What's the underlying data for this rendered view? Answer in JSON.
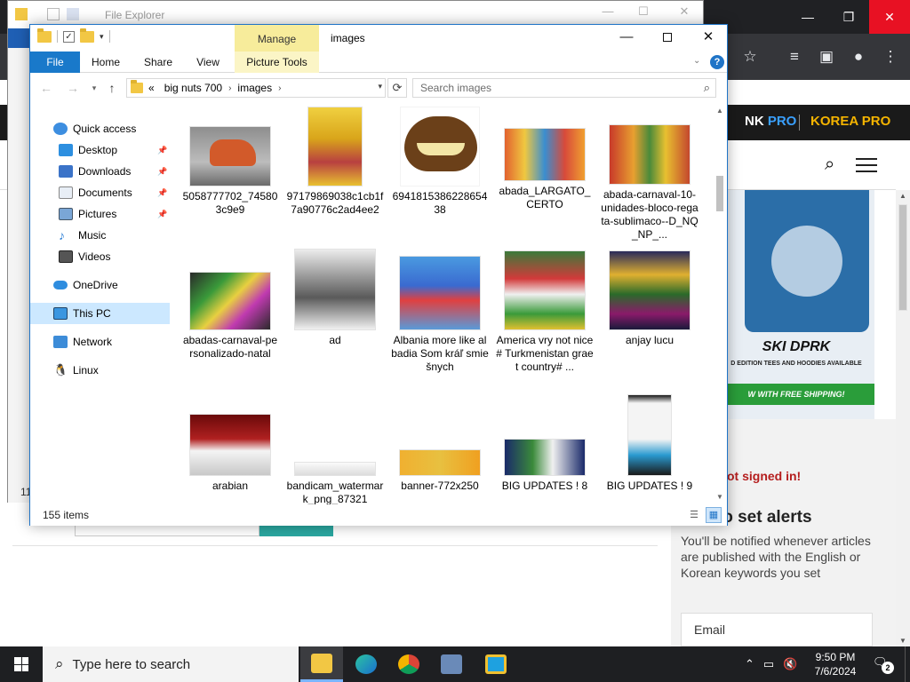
{
  "browser": {
    "header_left": "NK",
    "header_left_accent": "PRO",
    "header_right": "KOREA PRO",
    "ad_title": "SKI DPRK",
    "ad_sub": "D EDITION TEES AND HOODIES AVAILABLE",
    "ad_ship": "W WITH FREE SHIPPING!",
    "not_signed": "ot signed in!",
    "signin_title": "n to set alerts",
    "signin_desc": "You'll be notified whenever articles are published with the English or Korean keywords you set",
    "email_placeholder": "Email",
    "accent_red": "#b51e1e",
    "accent_green": "#2a9d3a"
  },
  "back_window": {
    "title": "File Explorer",
    "partial_count": "11"
  },
  "explorer": {
    "title": "images",
    "manage_label": "Manage",
    "tabs": {
      "file": "File",
      "home": "Home",
      "share": "Share",
      "view": "View",
      "picture_tools": "Picture Tools"
    },
    "address": {
      "overflow": "«",
      "crumbs": [
        "big nuts 700",
        "images"
      ]
    },
    "search_placeholder": "Search images",
    "nav": [
      {
        "label": "Quick access",
        "icon": "star-icon",
        "pinned": false
      },
      {
        "label": "Desktop",
        "icon": "desktop-icon",
        "pinned": true
      },
      {
        "label": "Downloads",
        "icon": "download-icon",
        "pinned": true
      },
      {
        "label": "Documents",
        "icon": "document-icon",
        "pinned": true
      },
      {
        "label": "Pictures",
        "icon": "picture-icon",
        "pinned": true
      },
      {
        "label": "Music",
        "icon": "music-icon",
        "pinned": false
      },
      {
        "label": "Videos",
        "icon": "video-icon",
        "pinned": false
      },
      {
        "label": "OneDrive",
        "icon": "cloud-icon",
        "pinned": false
      },
      {
        "label": "This PC",
        "icon": "computer-icon",
        "pinned": false,
        "selected": true
      },
      {
        "label": "Network",
        "icon": "network-icon",
        "pinned": false
      },
      {
        "label": "Linux",
        "icon": "linux-icon",
        "pinned": false
      }
    ],
    "files": [
      {
        "name": "5058777702_745803c9e9",
        "color": "#8a5a3a"
      },
      {
        "name": "97179869038c1cb1f7a90776c2ad4ee2",
        "color": "#e0b200"
      },
      {
        "name": "694181538622865438",
        "color": "#5a3a1a"
      },
      {
        "name": "abada_LARGATO_CERTO",
        "color": "#d95a2b"
      },
      {
        "name": "abada-carnaval-10-unidades-bloco-regata-sublimaco--D_NQ_NP_...",
        "color": "#c4472d"
      },
      {
        "name": "abadas-carnaval-personalizado-natal",
        "color": "#3a8a3a"
      },
      {
        "name": "ad",
        "color": "#6a6a6a"
      },
      {
        "name": "Albania more like albadia Som kráľ smiešnych",
        "color": "#3a6ad0"
      },
      {
        "name": "America vry not nice# Turkmenistan graet country# ...",
        "color": "#d23a3a"
      },
      {
        "name": "anjay lucu",
        "color": "#2a2a6a"
      },
      {
        "name": "arabian",
        "color": "#8a1a1a"
      },
      {
        "name": "bandicam_watermark_png_87321",
        "color": "#dcdcdc"
      },
      {
        "name": "banner-772x250",
        "color": "#e8a020"
      },
      {
        "name": "BIG UPDATES ! 8",
        "color": "#1a2a6a"
      },
      {
        "name": "BIG UPDATES ! 9",
        "color": "#1a1a1a"
      }
    ],
    "status": {
      "count": "155 items"
    }
  },
  "taskbar": {
    "search_placeholder": "Type here to search",
    "time": "9:50 PM",
    "date": "7/6/2024",
    "notifications": "2"
  }
}
